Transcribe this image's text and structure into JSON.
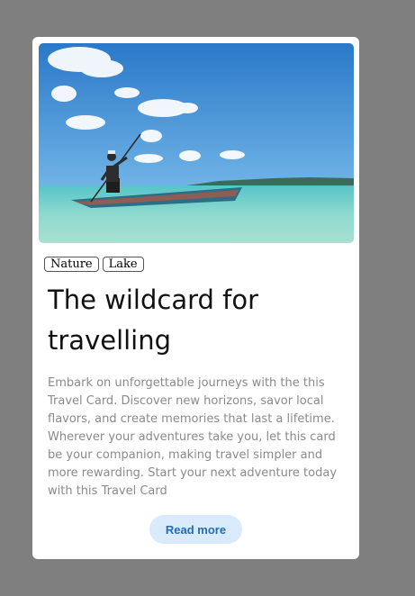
{
  "card": {
    "tags": [
      "Nature",
      "Lake"
    ],
    "title": "The wildcard for travelling",
    "description": "Embark on unforgettable journeys with the this Travel Card. Discover new horizons, savor local flavors, and create memories that last a lifetime. Wherever your adventures take you, let this card be your companion, making travel simpler and more rewarding. Start your next adventure today with this Travel Card",
    "button_label": "Read more"
  },
  "colors": {
    "background": "#7f7f7f",
    "card": "#ffffff",
    "button_bg": "#d9ebfb",
    "button_text": "#1f6cb8",
    "description_text": "#8a8a8a"
  }
}
